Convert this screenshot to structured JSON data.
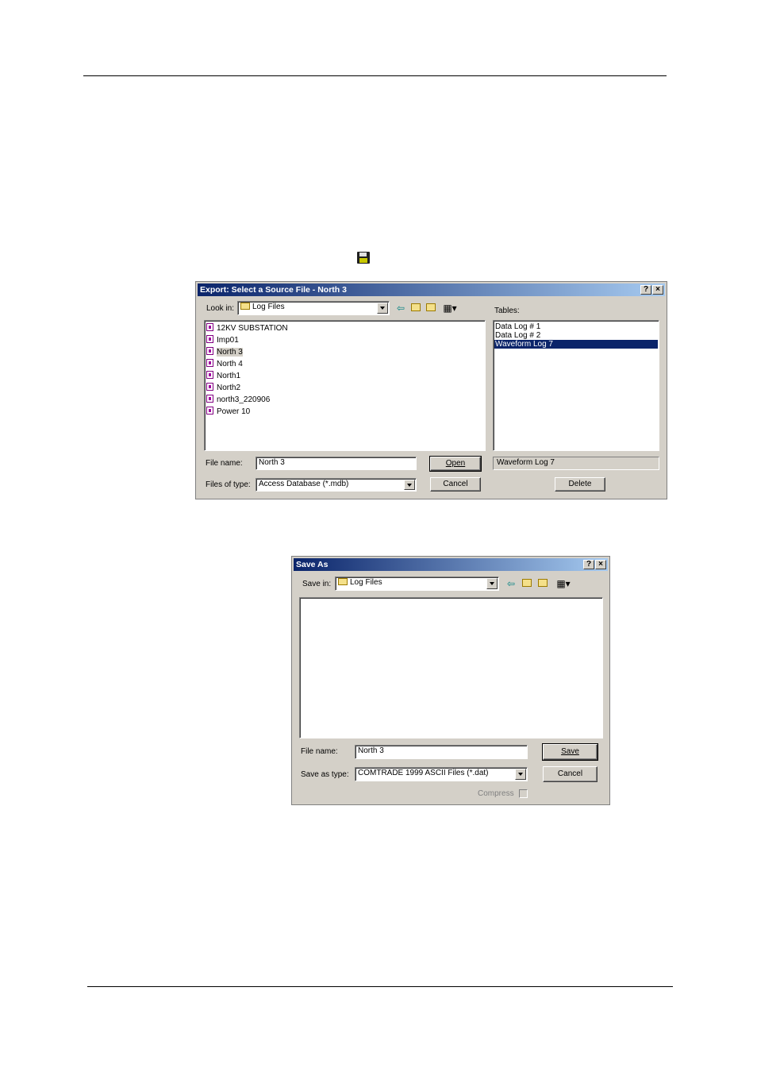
{
  "export_dialog": {
    "title": "Export: Select a Source File - North 3",
    "help_btn": "?",
    "close_btn": "×",
    "look_in_label": "Look in:",
    "look_in_value": "Log Files",
    "tables_label": "Tables:",
    "files": [
      "12KV SUBSTATION",
      "Imp01",
      "North 3",
      "North 4",
      "North1",
      "North2",
      "north3_220906",
      "Power 10"
    ],
    "tables": [
      "Data Log # 1",
      "Data Log # 2",
      "Waveform Log 7"
    ],
    "file_name_label": "File name:",
    "file_name_value": "North 3",
    "files_of_type_label": "Files of type:",
    "files_of_type_value": "Access Database (*.mdb)",
    "open_btn": "Open",
    "cancel_btn": "Cancel",
    "selected_table": "Waveform Log 7",
    "delete_btn": "Delete"
  },
  "save_dialog": {
    "title": "Save As",
    "help_btn": "?",
    "close_btn": "×",
    "save_in_label": "Save in:",
    "save_in_value": "Log Files",
    "file_name_label": "File name:",
    "file_name_value": "North 3",
    "save_as_type_label": "Save as type:",
    "save_as_type_value": "COMTRADE 1999 ASCII Files (*.dat)",
    "save_btn": "Save",
    "cancel_btn": "Cancel",
    "compress_label": "Compress"
  }
}
